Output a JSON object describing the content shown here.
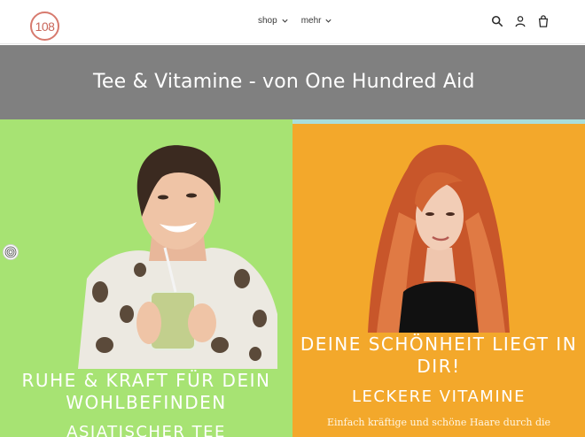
{
  "header": {
    "logo_text": "108",
    "nav": [
      {
        "label": "shop"
      },
      {
        "label": "mehr"
      }
    ],
    "icons": [
      "search-icon",
      "account-icon",
      "cart-icon"
    ]
  },
  "banner": {
    "title": "Tee & Vitamine - von One Hundred Aid",
    "background": "#808080"
  },
  "left_panel": {
    "background": "#a7e373",
    "heading_line1": "RUHE & KRAFT FÜR DEIN",
    "heading_line2": "WOHLBEFINDEN",
    "subheading": "ASIATISCHER TEE"
  },
  "right_panel": {
    "background": "#f3a82b",
    "heading_line1": "DEINE SCHÖNHEIT LIEGT IN",
    "heading_line2": "DIR!",
    "subheading": "LECKERE VITAMINE",
    "text": "Einfach kräftige und schöne Haare durch die"
  },
  "colors": {
    "logo": "#d77a6e",
    "accent_strip": "#a9dedb"
  }
}
